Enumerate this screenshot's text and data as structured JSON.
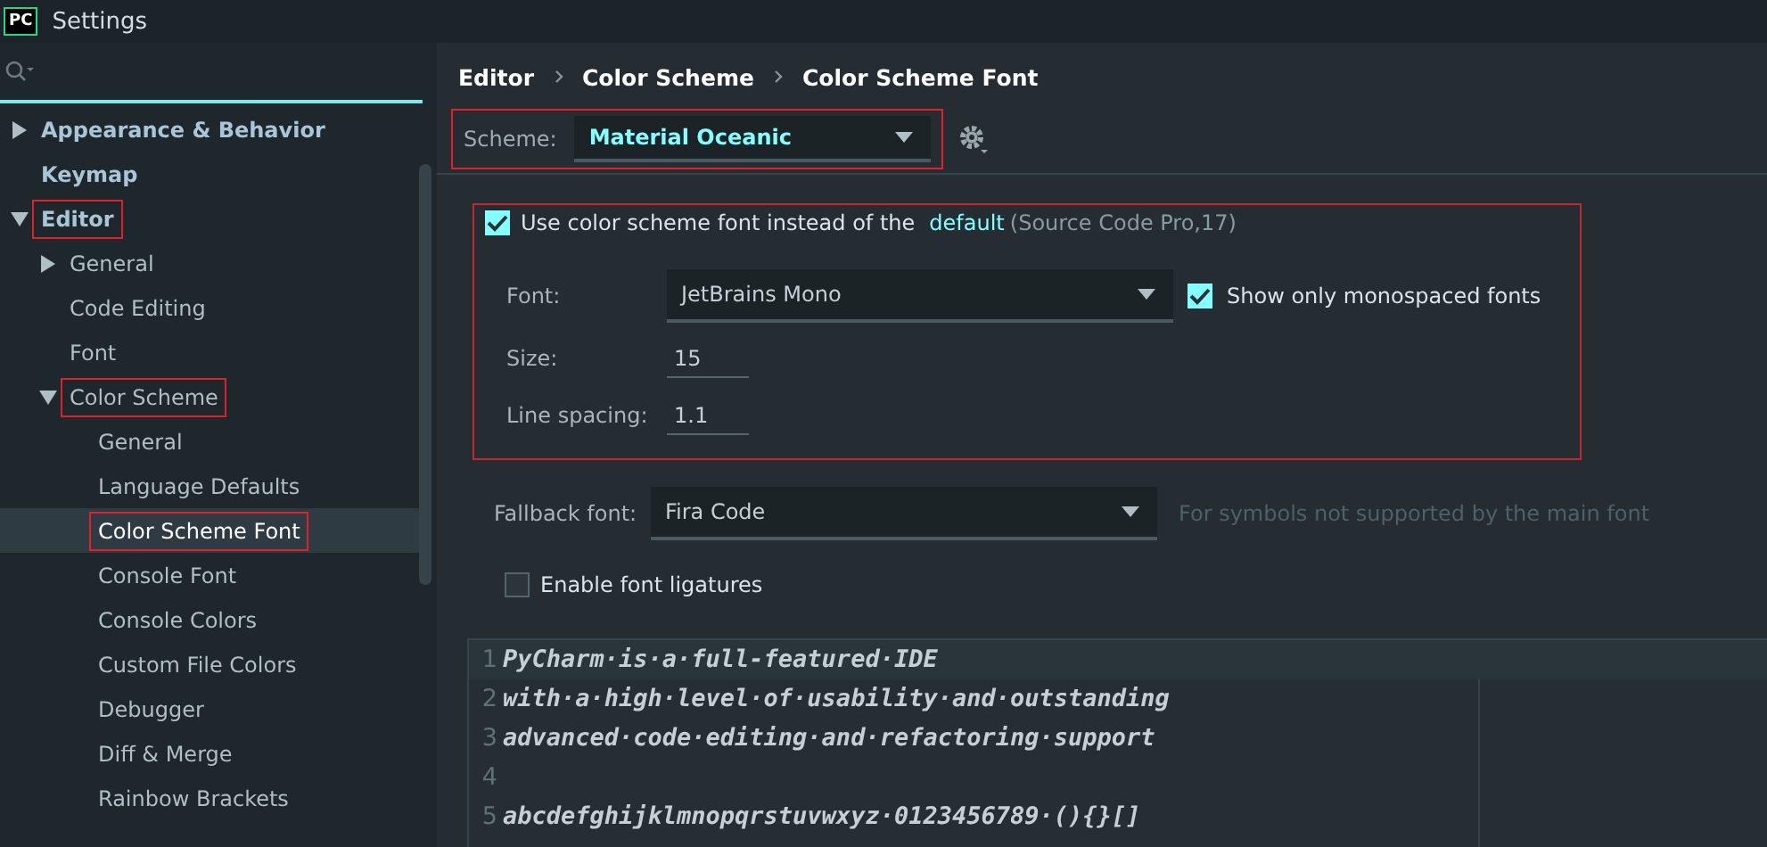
{
  "window": {
    "title": "Settings",
    "logo": "PC"
  },
  "sidebar": {
    "items": [
      {
        "label": "Appearance & Behavior",
        "expanded": false,
        "selected": false,
        "highlighted": false
      },
      {
        "label": "Keymap",
        "selected": false,
        "highlighted": false
      },
      {
        "label": "Editor",
        "expanded": true,
        "selected": false,
        "highlighted": true,
        "children": [
          {
            "label": "General",
            "expanded": false,
            "selected": false,
            "highlighted": false
          },
          {
            "label": "Code Editing",
            "selected": false,
            "highlighted": false
          },
          {
            "label": "Font",
            "selected": false,
            "highlighted": false
          },
          {
            "label": "Color Scheme",
            "expanded": true,
            "selected": false,
            "highlighted": true,
            "children": [
              {
                "label": "General",
                "selected": false,
                "highlighted": false
              },
              {
                "label": "Language Defaults",
                "selected": false,
                "highlighted": false
              },
              {
                "label": "Color Scheme Font",
                "selected": true,
                "highlighted": true
              },
              {
                "label": "Console Font",
                "selected": false,
                "highlighted": false
              },
              {
                "label": "Console Colors",
                "selected": false,
                "highlighted": false
              },
              {
                "label": "Custom File Colors",
                "selected": false,
                "highlighted": false
              },
              {
                "label": "Debugger",
                "selected": false,
                "highlighted": false
              },
              {
                "label": "Diff & Merge",
                "selected": false,
                "highlighted": false
              },
              {
                "label": "Rainbow Brackets",
                "selected": false,
                "highlighted": false
              }
            ]
          }
        ]
      }
    ]
  },
  "breadcrumb": [
    "Editor",
    "Color Scheme",
    "Color Scheme Font"
  ],
  "scheme": {
    "label": "Scheme:",
    "value": "Material Oceanic",
    "highlighted": true
  },
  "font_group": {
    "highlighted": true,
    "use_scheme_font": {
      "checked": true,
      "label": "Use color scheme font instead of the",
      "link": "default",
      "note": "(Source Code Pro,17)"
    },
    "font": {
      "label": "Font:",
      "value": "JetBrains Mono"
    },
    "monospaced": {
      "checked": true,
      "label": "Show only monospaced fonts"
    },
    "size": {
      "label": "Size:",
      "value": "15"
    },
    "line_spacing": {
      "label": "Line spacing:",
      "value": "1.1"
    }
  },
  "fallback": {
    "label": "Fallback font:",
    "value": "Fira Code",
    "hint": "For symbols not supported by the main font"
  },
  "ligatures": {
    "checked": false,
    "label": "Enable font ligatures"
  },
  "preview": {
    "lines": [
      {
        "number": "1",
        "text": "PyCharm·is·a·full-featured·IDE"
      },
      {
        "number": "2",
        "text": "with·a·high·level·of·usability·and·outstanding"
      },
      {
        "number": "3",
        "text": "advanced·code·editing·and·refactoring·support"
      },
      {
        "number": "4"
      },
      {
        "number": "5",
        "text": "abcdefghijklmnopqrstuvwxyz·0123456789·(){}[]"
      }
    ]
  }
}
